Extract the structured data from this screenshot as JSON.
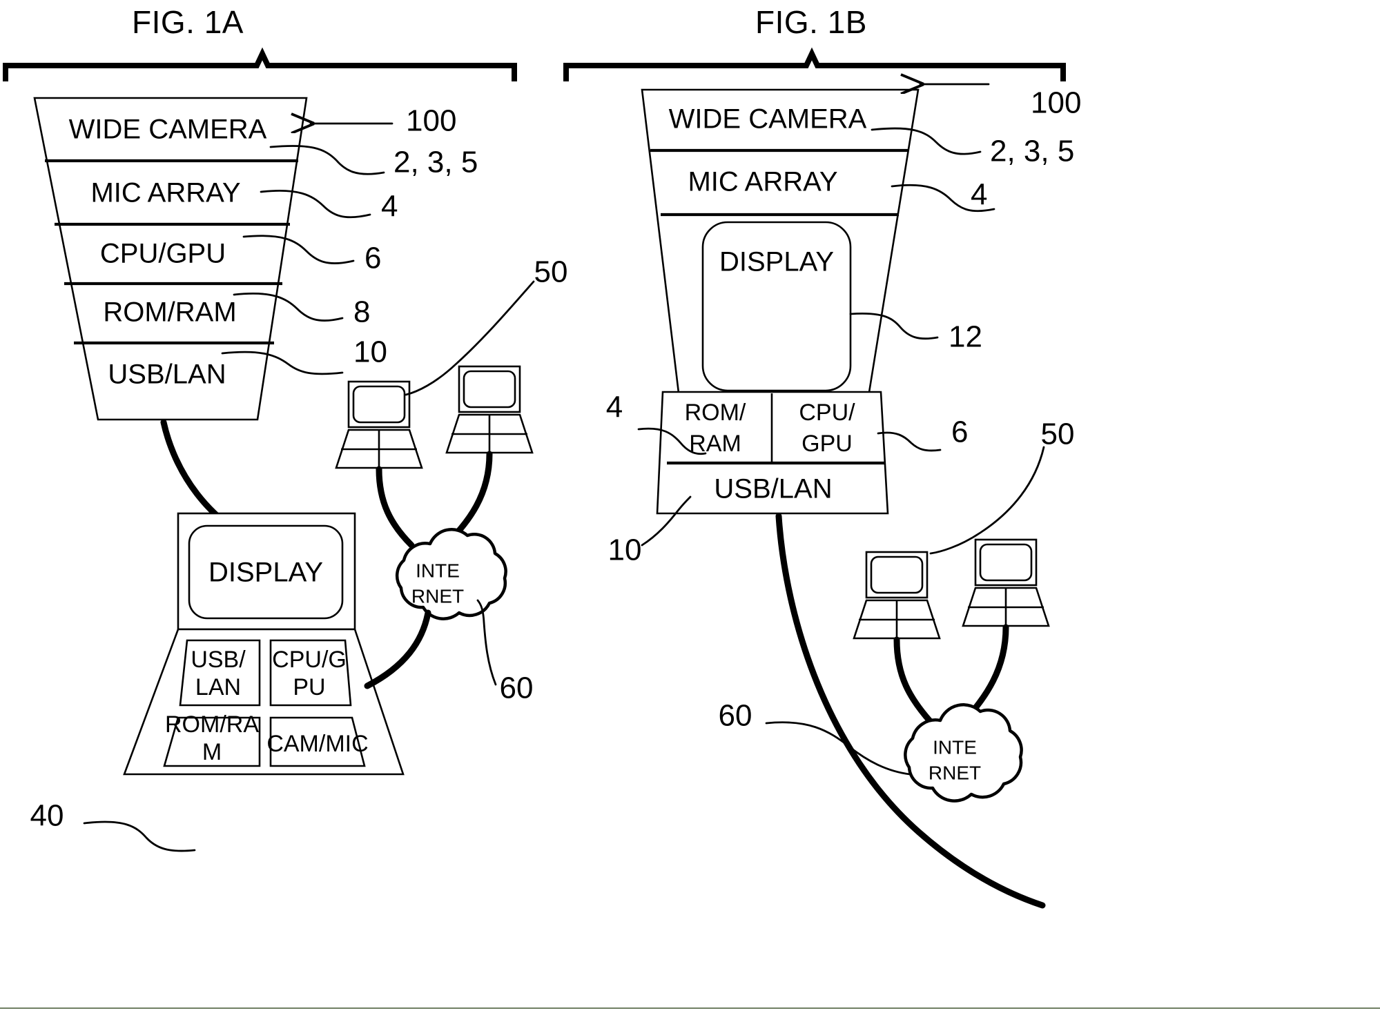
{
  "figures": [
    {
      "id": "fig-1a",
      "title": "FIG. 1A",
      "device": {
        "label": "device-stack-1a",
        "layers": [
          {
            "label": "WIDE CAMERA",
            "ref": "2, 3, 5"
          },
          {
            "label": "MIC ARRAY",
            "ref": "4"
          },
          {
            "label": "CPU/GPU",
            "ref": "6"
          },
          {
            "label": "ROM/RAM",
            "ref": "8"
          },
          {
            "label": "USB/LAN",
            "ref": "10"
          }
        ],
        "device_ref": "100"
      },
      "laptop": {
        "ref": "40",
        "display_label": "DISPLAY",
        "modules": [
          "USB/ LAN",
          "CPU/G PU",
          "ROM/RA M",
          "CAM/MIC"
        ],
        "modules_lines": [
          [
            "USB/",
            "LAN"
          ],
          [
            "CPU/G",
            "PU"
          ],
          [
            "ROM/RA",
            "M"
          ],
          [
            "CAM/MIC",
            ""
          ]
        ]
      },
      "network": {
        "cloud_label_lines": [
          "INTE",
          "RNET"
        ],
        "cloud_ref": "60",
        "clients_ref": "50",
        "client_count": 2
      }
    },
    {
      "id": "fig-1b",
      "title": "FIG. 1B",
      "device": {
        "label": "device-stack-1b",
        "layers": [
          {
            "label": "WIDE CAMERA",
            "ref": "2, 3, 5"
          },
          {
            "label": "MIC ARRAY",
            "ref": "4"
          }
        ],
        "display_label": "DISPLAY",
        "display_ref": "12",
        "base_left": {
          "lines": [
            "ROM/",
            "RAM"
          ],
          "ref": "4"
        },
        "base_right": {
          "lines": [
            "CPU/",
            "GPU"
          ],
          "ref": "6"
        },
        "base_bottom": {
          "label": "USB/LAN",
          "ref": "10"
        },
        "device_ref": "100"
      },
      "network": {
        "cloud_label_lines": [
          "INTE",
          "RNET"
        ],
        "cloud_ref": "60",
        "clients_ref": "50",
        "client_count": 2
      }
    }
  ],
  "style": {
    "ink": "#000000",
    "paper": "#ffffff",
    "footer_rule": "#6f7f63"
  }
}
